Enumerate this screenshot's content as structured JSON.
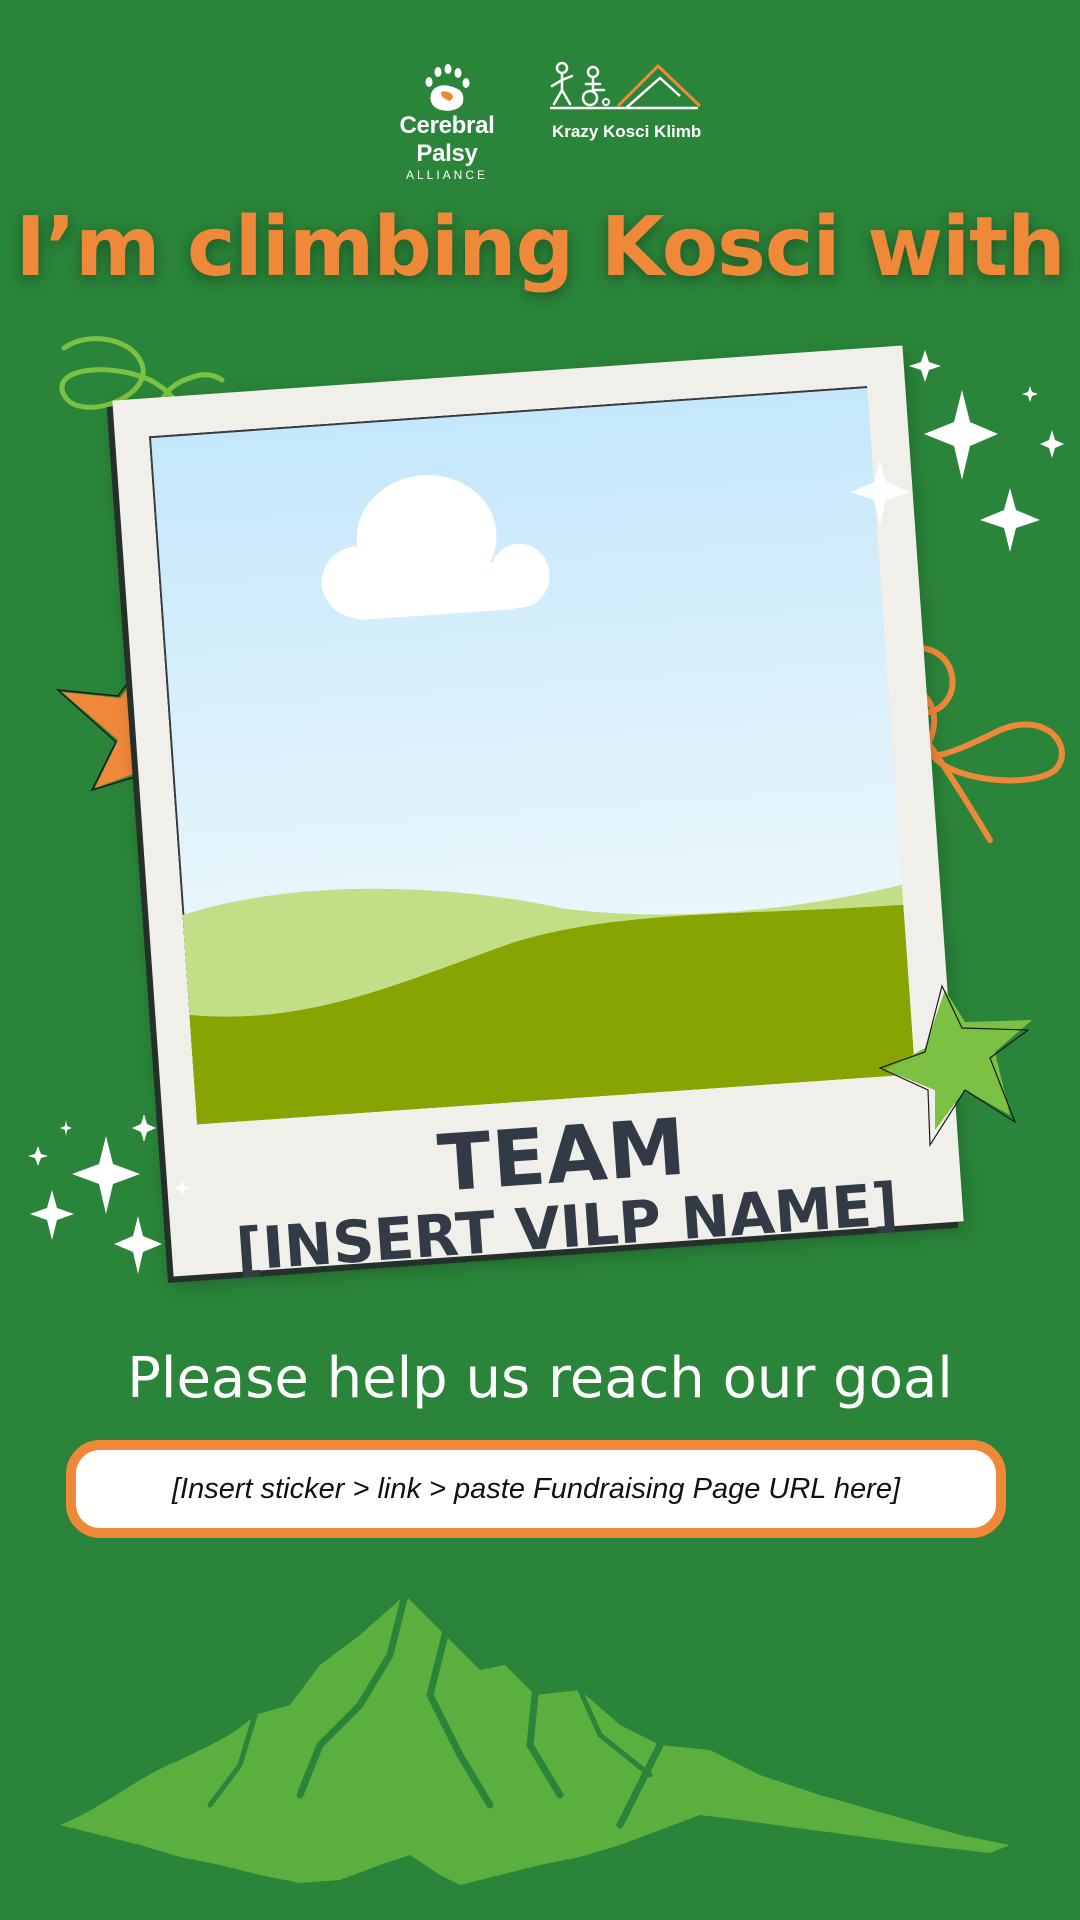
{
  "header": {
    "cpa_logo_name": "Cerebral Palsy",
    "cpa_logo_sub": "ALLIANCE",
    "kkk_logo_name": "Krazy Kosci Klimb"
  },
  "headline": "I’m climbing Kosci with",
  "polaroid": {
    "team_label": "TEAM",
    "team_name": "[INSERT VILP NAME]"
  },
  "goal_text": "Please help us reach our goal",
  "link_placeholder": "[Insert sticker > link > paste Fundraising Page URL here]",
  "colors": {
    "background": "#2a8439",
    "accent_orange": "#f0883a",
    "light_green": "#7cc143",
    "polaroid_frame": "#f1efea",
    "caption_text": "#323a45"
  },
  "icons": [
    "handprint-logo-icon",
    "climbers-mountain-logo-icon",
    "sparkle-icon",
    "star-icon",
    "squiggle-icon",
    "cloud-icon",
    "mountain-silhouette-icon"
  ]
}
